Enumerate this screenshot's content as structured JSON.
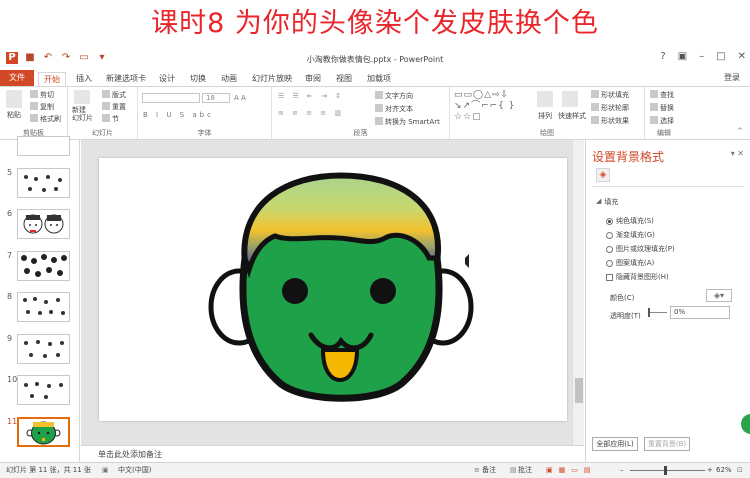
{
  "banner": {
    "text": "课时8 为你的头像染个发皮肤换个色"
  },
  "window": {
    "title": "小淘教你做表情包.pptx - PowerPoint"
  },
  "menu": {
    "file": "文件",
    "home": "开始",
    "insert": "插入",
    "new_tab": "新建选项卡",
    "design": "设计",
    "transitions": "切换",
    "animations": "动画",
    "slideshow": "幻灯片放映",
    "review": "审阅",
    "view": "视图",
    "addins": "加载项",
    "login": "登录"
  },
  "ribbon": {
    "paste": "粘贴",
    "cut": "剪切",
    "copy": "复制",
    "format_painter": "格式刷",
    "clipboard": "剪贴板",
    "new_slide": "新建\n幻灯片",
    "layout": "版式",
    "reset": "重置",
    "section": "节",
    "slides": "幻灯片",
    "font_size": "18",
    "font": "字体",
    "text_direction": "文字方向",
    "align_text": "对齐文本",
    "smartart": "转换为 SmartArt",
    "paragraph": "段落",
    "arrange": "排列",
    "quick_styles": "快速样式",
    "shape_fill": "形状填充",
    "shape_outline": "形状轮廓",
    "shape_effects": "形状效果",
    "drawing": "绘图",
    "find": "查找",
    "replace": "替换",
    "select": "选择",
    "editing": "编辑"
  },
  "thumbnails": {
    "numbers": [
      "5",
      "6",
      "7",
      "8",
      "9",
      "10",
      "11"
    ],
    "selected": "11"
  },
  "notes": {
    "placeholder": "单击此处添加备注"
  },
  "pane": {
    "title": "设置背景格式",
    "fill_header": "填充",
    "options": [
      "纯色填充(S)",
      "渐变填充(G)",
      "图片或纹理填充(P)",
      "图案填充(A)"
    ],
    "selected_option": "纯色填充(S)",
    "hide_graphics": "隐藏背景图形(H)",
    "color_label": "颜色(C)",
    "transparency_label": "透明度(T)",
    "transparency_value": "0%",
    "apply_all": "全部应用(L)",
    "reset_bg": "重置背景(B)"
  },
  "status": {
    "slide_info": "幻灯片 第 11 张，共 11 张",
    "language": "中文(中国)",
    "notes": "备注",
    "comments": "批注",
    "zoom": "62%"
  },
  "colors": {
    "accent": "#d24726",
    "banner_text": "#e8262c",
    "face_green": "#1fa14a",
    "hair_top": "#a9d38c",
    "hair_mid": "#f2c12e",
    "hair_bottom": "#3a3a96",
    "tongue": "#f5b800"
  }
}
